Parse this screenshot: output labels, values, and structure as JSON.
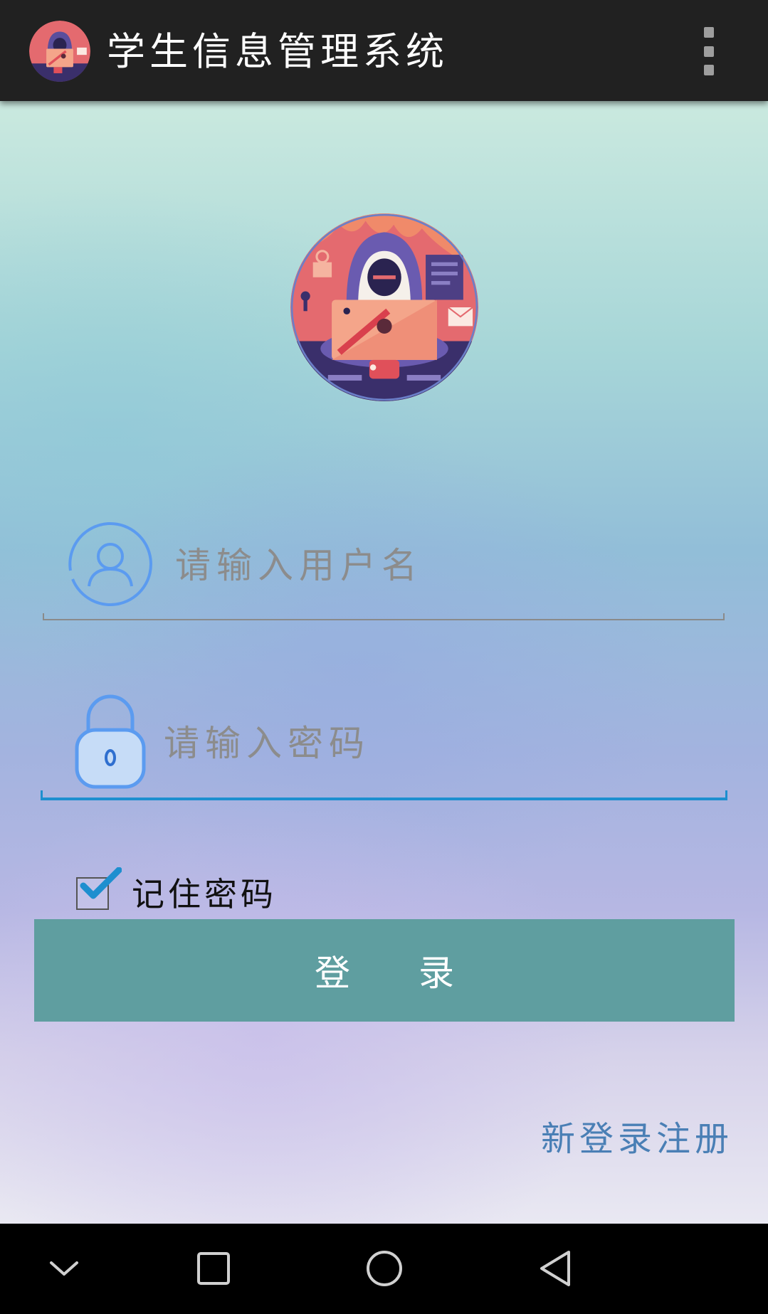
{
  "app_bar": {
    "title": "学生信息管理系统",
    "app_icon": "hacker-avatar-icon",
    "overflow_icon": "more-vertical-icon"
  },
  "login_form": {
    "avatar": "hacker-avatar-image",
    "username": {
      "icon": "user-circle-icon",
      "placeholder": "请输入用户名",
      "value": ""
    },
    "password": {
      "icon": "lock-icon",
      "placeholder": "请输入密码",
      "value": ""
    },
    "remember_password": {
      "label": "记住密码",
      "checked": true
    },
    "login_button_label": "登 录",
    "register_link_label": "新登录注册"
  },
  "navigation_bar": {
    "buttons": [
      "collapse-chevron-icon",
      "recents-square-icon",
      "home-circle-icon",
      "back-triangle-icon"
    ]
  },
  "colors": {
    "app_bar": "#212121",
    "login_button": "#5f9ea0",
    "focused_underline": "#1d8fcf",
    "register_link": "#4a7fb5",
    "icon_blue": "#5b9bf0"
  }
}
